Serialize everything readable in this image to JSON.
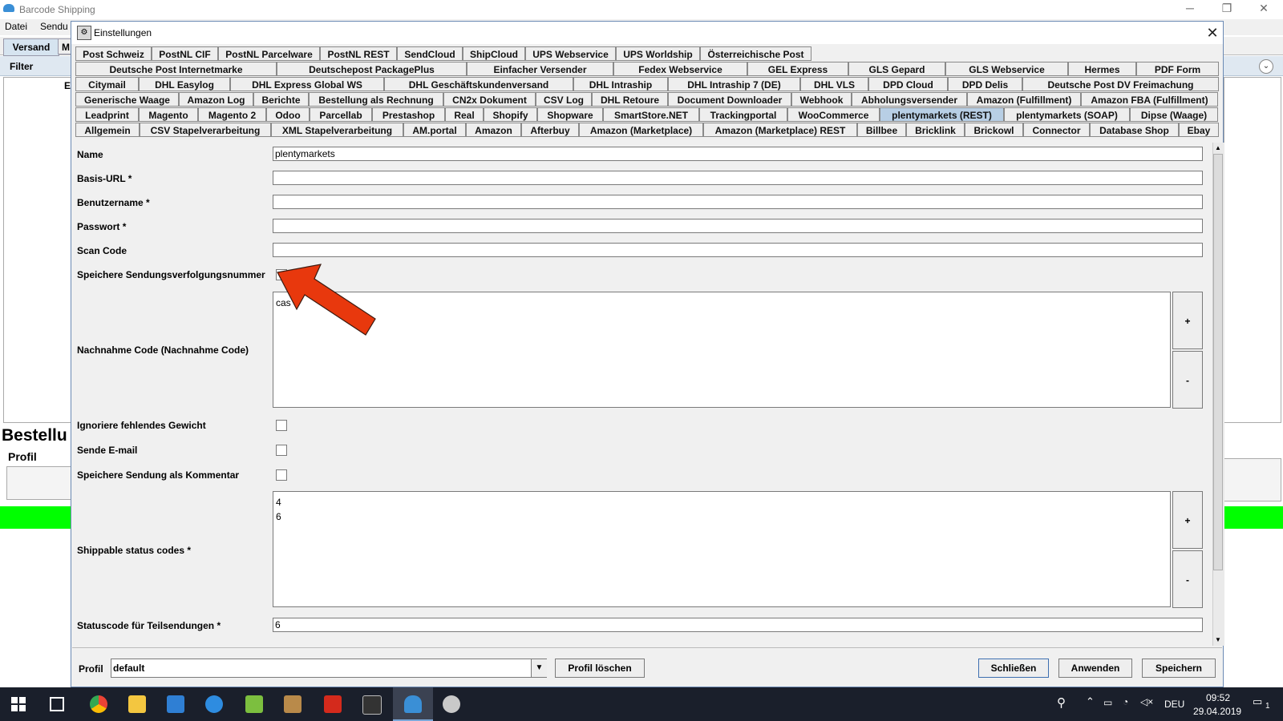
{
  "app": {
    "title": "Barcode Shipping",
    "menu": [
      "Datei",
      "Sendu"
    ],
    "tabs": [
      "Versand",
      "M"
    ],
    "filter_label": "Filter",
    "left_letter": "E",
    "bestellu": "Bestellu",
    "profil": "Profil"
  },
  "dialog": {
    "title": "Einstellungen",
    "close": "✕",
    "tab_rows": [
      [
        "Post Schweiz",
        "PostNL CIF",
        "PostNL Parcelware",
        "PostNL REST",
        "SendCloud",
        "ShipCloud",
        "UPS Webservice",
        "UPS Worldship",
        "Österreichische Post"
      ],
      [
        "Deutsche Post Internetmarke",
        "Deutschepost PackagePlus",
        "Einfacher Versender",
        "Fedex Webservice",
        "GEL Express",
        "GLS Gepard",
        "GLS Webservice",
        "Hermes",
        "PDF Form"
      ],
      [
        "Citymail",
        "DHL Easylog",
        "DHL Express Global WS",
        "DHL Geschäftskundenversand",
        "DHL Intraship",
        "DHL Intraship 7 (DE)",
        "DHL VLS",
        "DPD Cloud",
        "DPD Delis",
        "Deutsche Post DV Freimachung"
      ],
      [
        "Generische Waage",
        "Amazon Log",
        "Berichte",
        "Bestellung als Rechnung",
        "CN2x Dokument",
        "CSV Log",
        "DHL Retoure",
        "Document Downloader",
        "Webhook",
        "Abholungsversender",
        "Amazon (Fulfillment)",
        "Amazon FBA (Fulfillment)"
      ],
      [
        "Leadprint",
        "Magento",
        "Magento 2",
        "Odoo",
        "Parcellab",
        "Prestashop",
        "Real",
        "Shopify",
        "Shopware",
        "SmartStore.NET",
        "Trackingportal",
        "WooCommerce",
        "plentymarkets (REST)",
        "plentymarkets (SOAP)",
        "Dipse (Waage)"
      ],
      [
        "Allgemein",
        "CSV Stapelverarbeitung",
        "XML Stapelverarbeitung",
        "AM.portal",
        "Amazon",
        "Afterbuy",
        "Amazon (Marketplace)",
        "Amazon (Marketplace) REST",
        "Billbee",
        "Bricklink",
        "Brickowl",
        "Connector",
        "Database Shop",
        "Ebay"
      ]
    ],
    "selected_tab": "plentymarkets (REST)",
    "form": {
      "name_label": "Name",
      "name_value": "plentymarkets",
      "basis_url_label": "Basis-URL *",
      "basis_url_value": "",
      "benutzername_label": "Benutzername *",
      "benutzername_value": "",
      "passwort_label": "Passwort *",
      "passwort_value": "",
      "scan_code_label": "Scan Code",
      "scan_code_value": "",
      "speichere_tracking_label": "Speichere Sendungsverfolgungsnummer",
      "speichere_tracking_checked": false,
      "nachnahme_label": "Nachnahme Code (Nachnahme Code)",
      "nachnahme_value": "cas",
      "ignoriere_gewicht_label": "Ignoriere fehlendes Gewicht",
      "sende_email_label": "Sende E-mail",
      "speichere_kommentar_label": "Speichere Sendung als Kommentar",
      "shippable_label": "Shippable status codes *",
      "shippable_values": [
        "4",
        "6"
      ],
      "teilsendungen_label": "Statuscode für Teilsendungen *",
      "teilsendungen_value": "6",
      "add": "+",
      "remove": "-"
    },
    "bottom": {
      "profil_label": "Profil",
      "profil_value": "default",
      "profil_loeschen": "Profil löschen",
      "schliessen": "Schließen",
      "anwenden": "Anwenden",
      "speichern": "Speichern"
    }
  },
  "taskbar": {
    "language": "DEU",
    "time": "09:52",
    "date": "29.04.2019",
    "notifications": "1"
  },
  "colors": {
    "selected_tab": "#b8cfe5",
    "status_green": "#00ff00",
    "arrow": "#e8380d",
    "taskbar": "#1a1f2b"
  }
}
